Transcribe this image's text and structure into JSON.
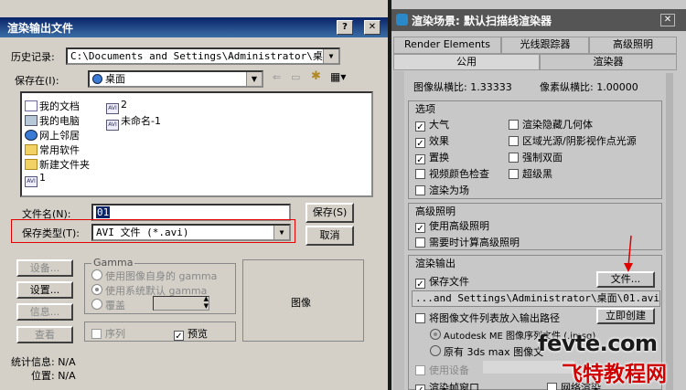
{
  "save_dialog": {
    "title": "渲染输出文件",
    "history_label": "历史记录:",
    "history_value": "C:\\Documents and Settings\\Administrator\\桌面",
    "save_in_label": "保存在(I):",
    "save_in_value": "桌面",
    "files": [
      {
        "name": "我的文档",
        "icon": "documents-icon"
      },
      {
        "name": "我的电脑",
        "icon": "computer-icon"
      },
      {
        "name": "网上邻居",
        "icon": "network-icon"
      },
      {
        "name": "常用软件",
        "icon": "folder-icon"
      },
      {
        "name": "新建文件夹",
        "icon": "folder-icon"
      },
      {
        "name": "1",
        "icon": "avi-file-icon"
      },
      {
        "name": "2",
        "icon": "avi-file-icon"
      },
      {
        "name": "未命名-1",
        "icon": "avi-file-icon"
      }
    ],
    "filename_label": "文件名(N):",
    "filename_value": "01",
    "filetype_label": "保存类型(T):",
    "filetype_value": "AVI 文件 (*.avi)",
    "save_button": "保存(S)",
    "cancel_button": "取消",
    "devices_button": "设备...",
    "setup_button": "设置...",
    "info_button": "信息...",
    "view_button": "查看",
    "gamma_title": "Gamma",
    "gamma_options": [
      "使用图像自身的 gamma",
      "使用系统默认 gamma",
      "覆盖"
    ],
    "gamma_selected": 1,
    "sequence_label": "序列",
    "preview_label": "预览",
    "image_label": "图像",
    "stats_label": "统计信息: N/A",
    "location_label": "位置: N/A"
  },
  "render_panel": {
    "title": "渲染场景: 默认扫描线渲染器",
    "tabs_row1": [
      "Render Elements",
      "光线跟踪器",
      "高级照明"
    ],
    "tabs_row2": [
      "公用",
      "渲染器"
    ],
    "aspect_label": "图像纵横比: 1.33333",
    "pixel_aspect_label": "像素纵横比: 1.00000",
    "options_title": "选项",
    "options_left": [
      {
        "label": "大气",
        "checked": true
      },
      {
        "label": "效果",
        "checked": true
      },
      {
        "label": "置换",
        "checked": true
      },
      {
        "label": "视频颜色检查",
        "checked": false
      },
      {
        "label": "渲染为场",
        "checked": false
      }
    ],
    "options_right": [
      {
        "label": "渲染隐藏几何体",
        "checked": false
      },
      {
        "label": "区域光源/阴影视作点光源",
        "checked": false
      },
      {
        "label": "强制双面",
        "checked": false
      },
      {
        "label": "超级黑",
        "checked": false
      }
    ],
    "gi_title": "高级照明",
    "gi_options": [
      {
        "label": "使用高级照明",
        "checked": true
      },
      {
        "label": "需要时计算高级照明",
        "checked": false
      }
    ],
    "output_title": "渲染输出",
    "save_file_label": "保存文件",
    "save_file_checked": true,
    "file_button": "文件...",
    "output_path": "...and Settings\\Administrator\\桌面\\01.avi",
    "put_image_label": "将图像文件列表放入输出路径",
    "create_now_button": "立即创建",
    "autodesk_option": "Autodesk ME 图像序列文件 (.imsq)",
    "legacy_option": "原有 3ds max 图像文",
    "use_device_label": "使用设备",
    "render_frame_label": "渲染帧窗口",
    "net_render_label": "网络渲染"
  },
  "watermark": {
    "line1": "fevte.com",
    "line2": "飞特教程网"
  }
}
